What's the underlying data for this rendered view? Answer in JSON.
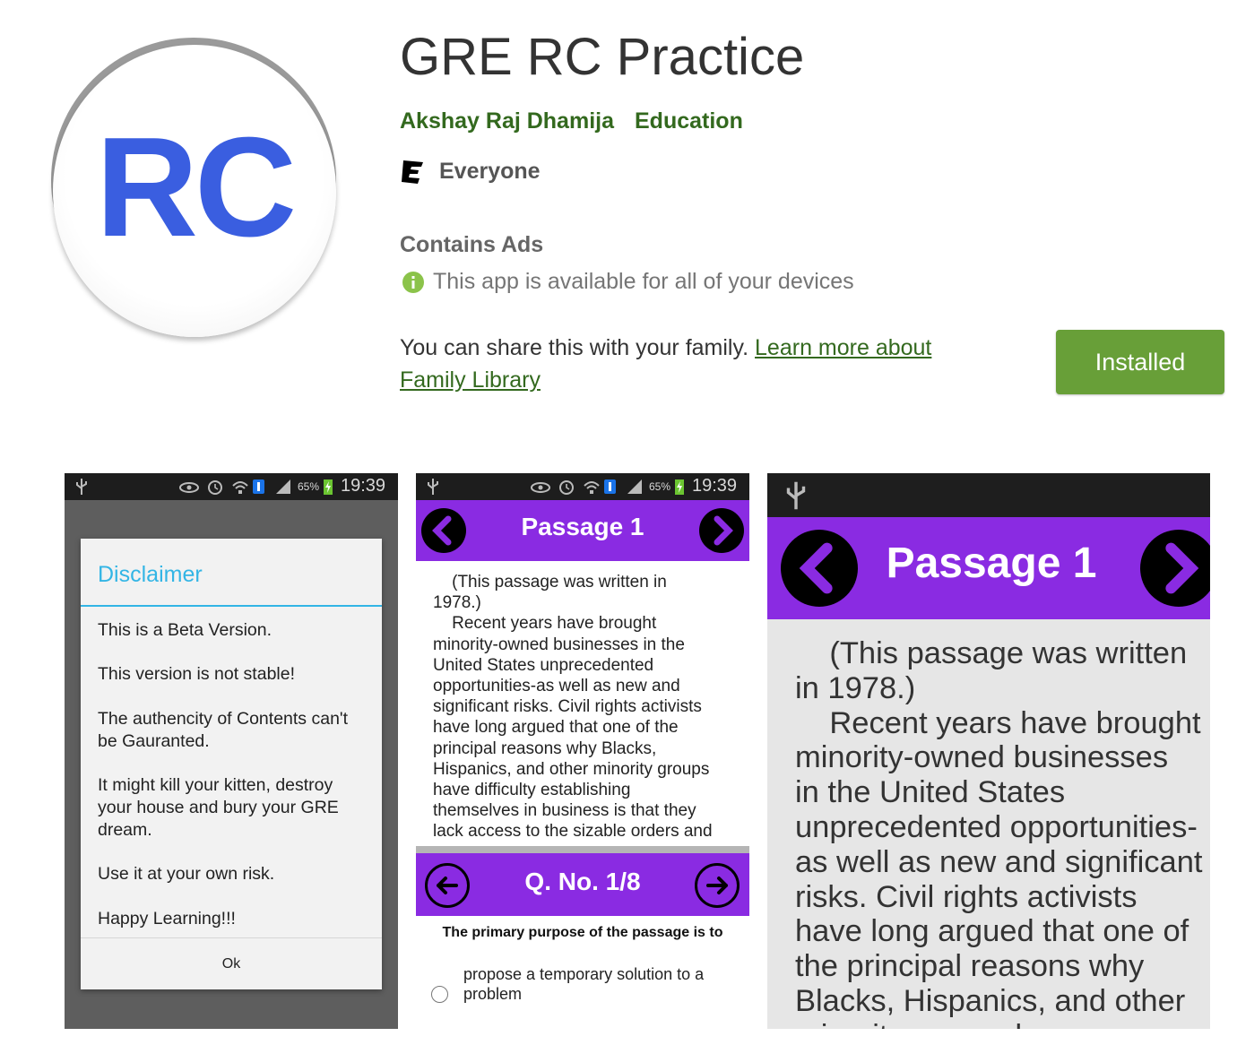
{
  "app": {
    "title": "GRE RC Practice",
    "icon_text": "RC",
    "developer": "Akshay Raj Dhamija",
    "category": "Education",
    "rating_label": "Everyone",
    "rating_icon": "esrb-e-icon",
    "contains_ads": "Contains Ads",
    "availability": "This app is available for all of your devices",
    "family_text": "You can share this with your family.",
    "family_link": "Learn more about Family Library",
    "install_button": "Installed"
  },
  "colors": {
    "green": "#689f38",
    "link_green": "#33691e",
    "purple": "#8a2be2",
    "dialog_blue": "#33b5e5",
    "icon_blue": "#3a5ee0"
  },
  "screenshots": {
    "status": {
      "battery": "65%",
      "time": "19:39"
    },
    "disclaimer": {
      "title": "Disclaimer",
      "lines": [
        "This is a Beta Version.",
        "This version is not stable!",
        "The authencity of Contents can't be Gauranted.",
        "It might kill your kitten, destroy your house and bury your GRE dream.",
        "Use it at your own risk.",
        "Happy Learning!!!"
      ],
      "ok": "Ok"
    },
    "passage": {
      "title": "Passage 1",
      "text_small": "    (This passage was written in\n1978.)\n    Recent years have brought\nminority-owned businesses in the\nUnited States unprecedented\nopportunities-as well as new and\nsignificant risks. Civil rights activists\nhave long argued that one of the\nprincipal reasons why Blacks,\nHispanics, and other minority groups\nhave difficulty establishing\nthemselves in business is that they\nlack access to the sizable orders and",
      "text_large": "    (This passage was written\nin 1978.)\n    Recent years have brought\nminority-owned businesses\nin the United States\nunprecedented opportunities-\nas well as new and significant\nrisks. Civil rights activists\nhave long argued that one of\nthe principal reasons why\nBlacks, Hispanics, and other\nminority groups have",
      "question_header": "Q. No. 1/8",
      "question": "The primary purpose of the passage is to",
      "option_1": "propose a temporary solution to a problem"
    }
  }
}
